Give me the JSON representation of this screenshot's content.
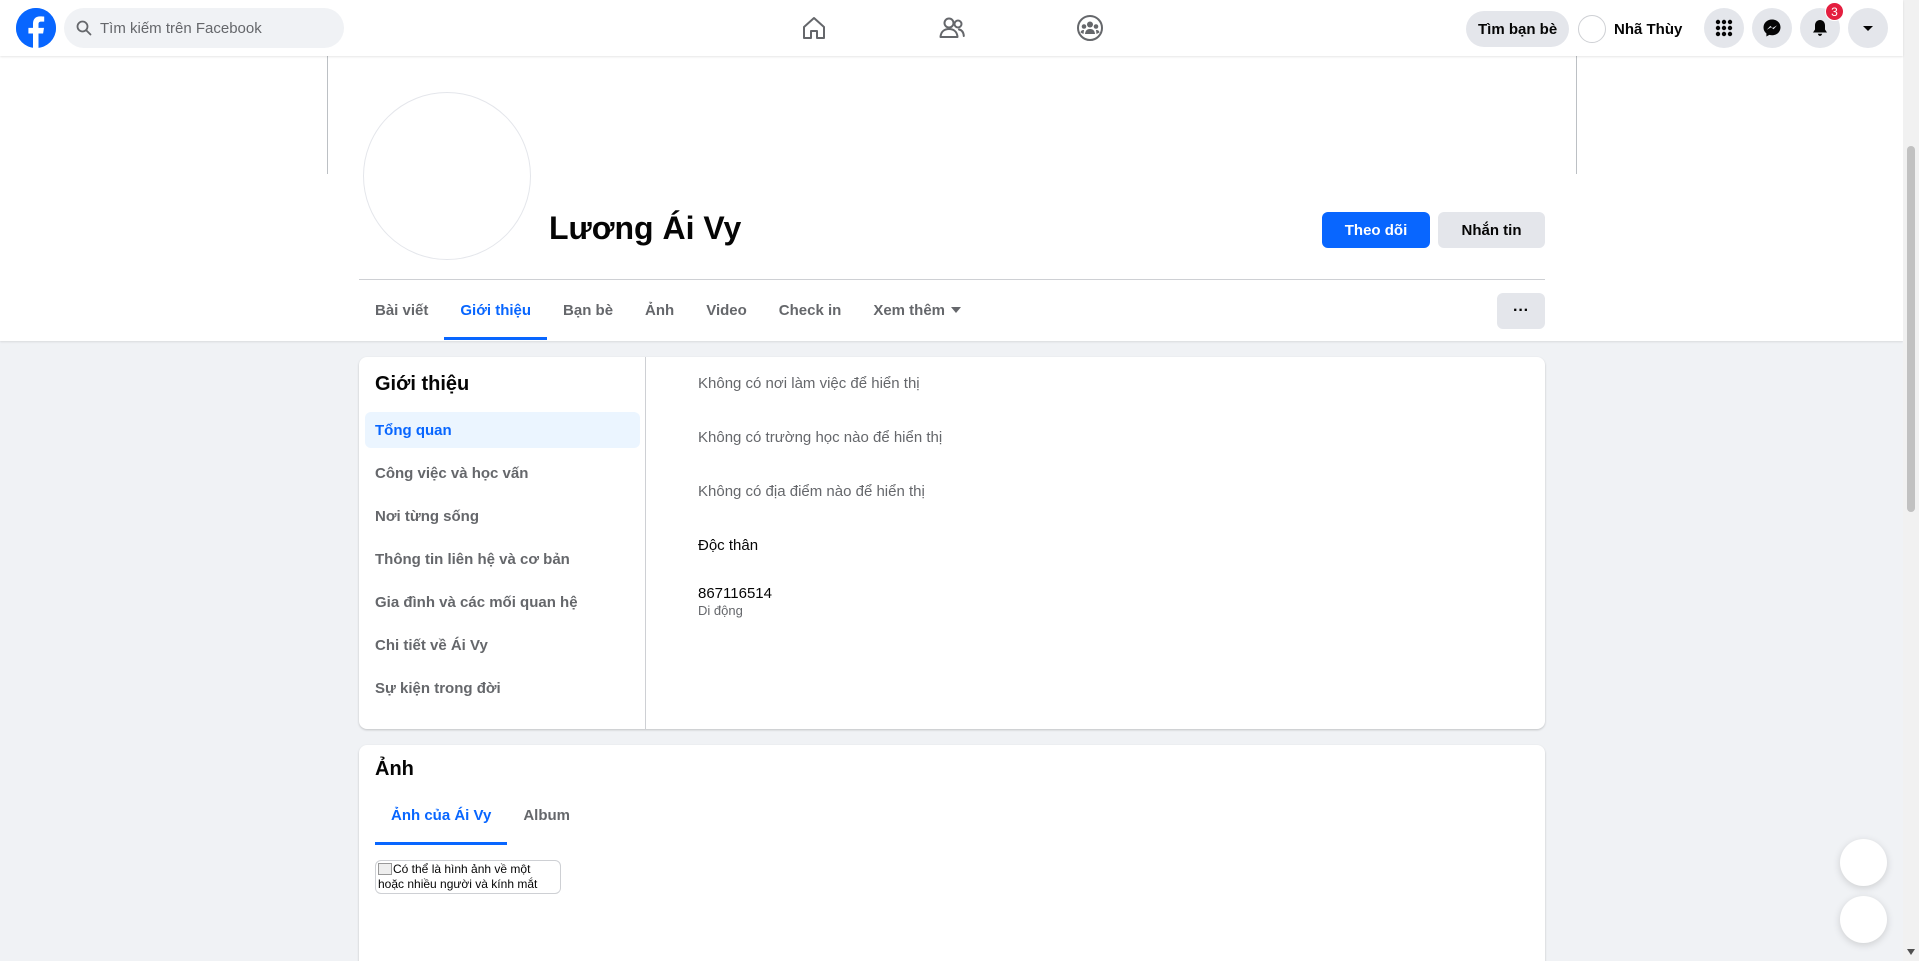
{
  "topbar": {
    "search_placeholder": "Tìm kiếm trên Facebook",
    "find_friends": "Tìm bạn bè",
    "user_name": "Nhã Thùy",
    "notification_count": "3"
  },
  "profile": {
    "name": "Lương Ái Vy",
    "follow_label": "Theo dõi",
    "message_label": "Nhắn tin",
    "more_label": "···"
  },
  "tabs": [
    {
      "label": "Bài viết"
    },
    {
      "label": "Giới thiệu"
    },
    {
      "label": "Bạn bè"
    },
    {
      "label": "Ảnh"
    },
    {
      "label": "Video"
    },
    {
      "label": "Check in"
    },
    {
      "label": "Xem thêm"
    }
  ],
  "about": {
    "title": "Giới thiệu",
    "menu": [
      {
        "label": "Tổng quan"
      },
      {
        "label": "Công việc và học vấn"
      },
      {
        "label": "Nơi từng sống"
      },
      {
        "label": "Thông tin liên hệ và cơ bản"
      },
      {
        "label": "Gia đình và các mối quan hệ"
      },
      {
        "label": "Chi tiết về Ái Vy"
      },
      {
        "label": "Sự kiện trong đời"
      }
    ],
    "no_work": "Không có nơi làm việc để hiển thị",
    "no_school": "Không có trường học nào để hiển thị",
    "no_place": "Không có địa điểm nào để hiển thị",
    "relationship": "Độc thân",
    "phone": "867116514",
    "phone_type": "Di động"
  },
  "photos": {
    "title": "Ảnh",
    "tabs": [
      {
        "label": "Ảnh của Ái Vy"
      },
      {
        "label": "Album"
      }
    ],
    "thumb_alt": "Có thể là hình ảnh về một hoặc nhiều người và kính mắt"
  },
  "colors": {
    "brand": "#0866ff",
    "badge": "#e41e3f",
    "background": "#f0f2f5"
  }
}
